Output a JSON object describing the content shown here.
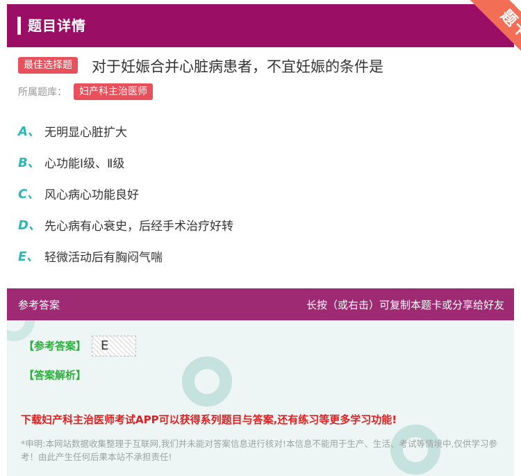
{
  "header": {
    "title": "题目详情",
    "ribbon": "题卡"
  },
  "question": {
    "tag": "最佳选择题",
    "text": "对于妊娠合并心脏病患者，不宜妊娠的条件是",
    "bank_label": "所属题库：",
    "bank_name": "妇产科主治医师"
  },
  "options": [
    {
      "letter": "A、",
      "text": "无明显心脏扩大"
    },
    {
      "letter": "B、",
      "text": "心功能Ⅰ级、Ⅱ级"
    },
    {
      "letter": "C、",
      "text": "风心病心功能良好"
    },
    {
      "letter": "D、",
      "text": "先心病有心衰史，后经手术治疗好转"
    },
    {
      "letter": "E、",
      "text": "轻微活动后有胸闷气喘"
    }
  ],
  "answer_section": {
    "title": "参考答案",
    "share_hint": "长按（或右击）可复制本题卡或分享给好友",
    "answer_label": "【参考答案】",
    "answer_value": "E",
    "analysis_label": "【答案解析】",
    "download_text": "下载妇产科主治医师考试APP可以获得系列题目与答案,还有练习等更多学习功能!",
    "disclaimer": "*申明:本网站数据收集整理于互联网,我们并未能对答案信息进行核对!本信息不能用于生产、生活、考试等情境中,仅供学习参考！由此产生任何后果本站不承担责任!"
  },
  "colors": {
    "header": "#9b0e66",
    "answer_header": "#9e2a74",
    "tag": "#e8505b",
    "option_letter": "#2bb6b8",
    "highlight_green": "#2bae3b",
    "download_red": "#e02020"
  }
}
